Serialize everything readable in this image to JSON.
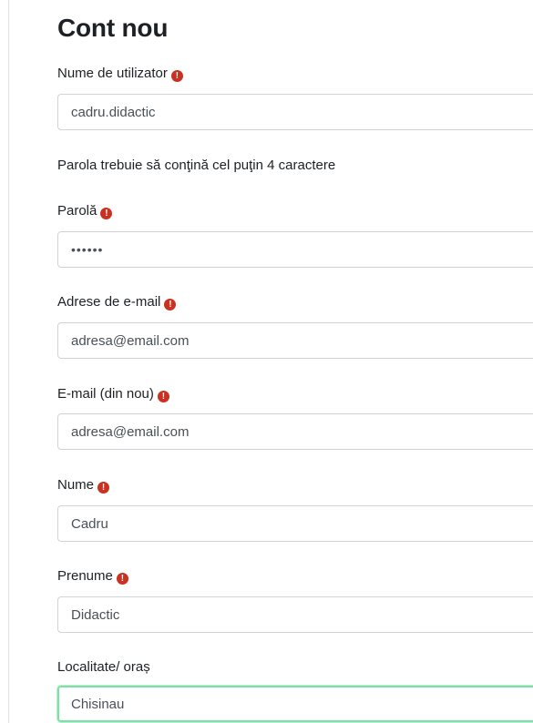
{
  "page": {
    "title": "Cont nou"
  },
  "form": {
    "username": {
      "label": "Nume de utilizator",
      "value": "cadru.didactic",
      "required": true
    },
    "password_note": "Parola trebuie să conţină cel puţin 4 caractere",
    "password": {
      "label": "Parolă",
      "value": "••••••",
      "required": true
    },
    "email": {
      "label": "Adrese de e-mail",
      "value": "adresa@email.com",
      "required": true
    },
    "email_again": {
      "label": "E-mail (din nou)",
      "value": "adresa@email.com",
      "required": true
    },
    "lastname": {
      "label": "Nume",
      "value": "Cadru",
      "required": true
    },
    "firstname": {
      "label": "Prenume",
      "value": "Didactic",
      "required": true
    },
    "city": {
      "label": "Localitate/ oraș",
      "value": "Chisinau",
      "required": false
    }
  },
  "icons": {
    "required": "exclamation-circle-icon",
    "required_glyph": "!"
  },
  "colors": {
    "required_icon": "#ca3120",
    "focus_border": "#7ee0a6",
    "input_border": "#ced4da"
  }
}
